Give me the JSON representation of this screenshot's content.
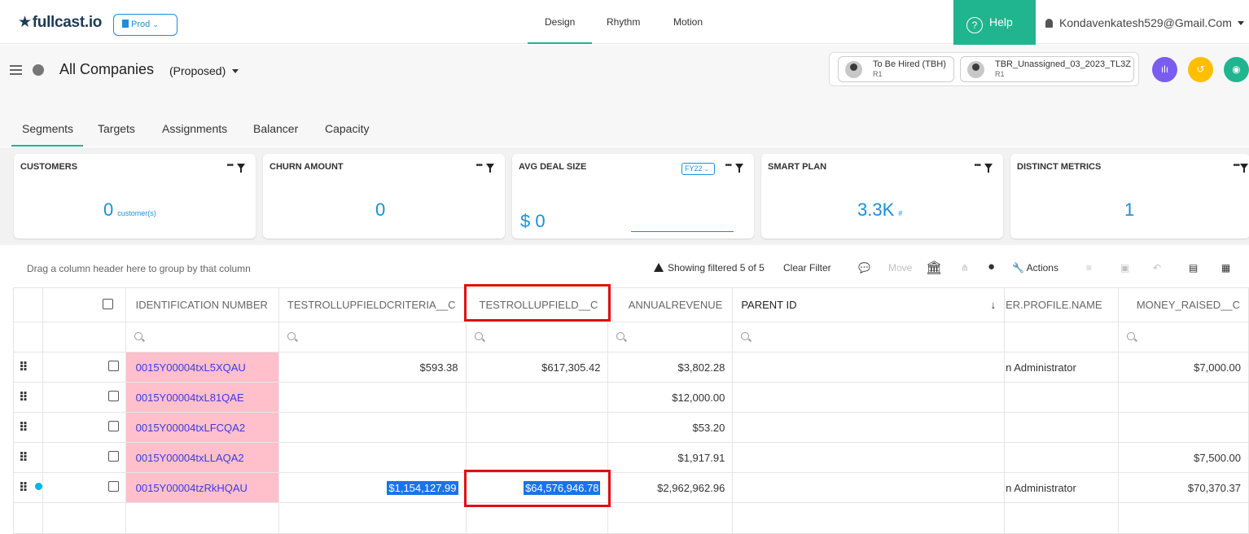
{
  "topbar": {
    "logo": "fullcast.io",
    "env_label": "Prod",
    "nav": [
      "Design",
      "Rhythm",
      "Motion"
    ],
    "help_label": "Help",
    "user_email": "Kondavenkatesh529@Gmail.Com"
  },
  "header": {
    "title": "All Companies",
    "view": "(Proposed)",
    "people": [
      {
        "name": "To Be Hired (TBH)",
        "role": "R1"
      },
      {
        "name": "TBR_Unassigned_03_2023_TL3Z",
        "role": "R1"
      }
    ],
    "colors": {
      "accent": "#20b58e",
      "link": "#1a8fd6",
      "purple": "#7b5cf0",
      "yellow": "#ffbf00",
      "teal": "#20b58e"
    }
  },
  "tabs": [
    "Segments",
    "Targets",
    "Assignments",
    "Balancer",
    "Capacity"
  ],
  "cards": [
    {
      "label": "CUSTOMERS",
      "value": "0",
      "unit": "customer(s)"
    },
    {
      "label": "CHURN AMOUNT",
      "value": "0",
      "unit": ""
    },
    {
      "label": "AVG DEAL SIZE",
      "value": "$ 0",
      "unit": "",
      "period": "FY22"
    },
    {
      "label": "SMART PLAN",
      "value": "3.3K",
      "unit": "#"
    },
    {
      "label": "DISTINCT METRICS",
      "value": "1",
      "unit": ""
    }
  ],
  "grid_toolbar": {
    "drag_hint": "Drag a column header here to group by that column",
    "filter_status": "Showing filtered 5 of 5",
    "clear_filter": "Clear Filter",
    "move": "Move",
    "actions": "Actions"
  },
  "table": {
    "columns": [
      "IDENTIFICATION NUMBER",
      "TESTROLLUPFIELDCRITERIA__C",
      "TESTROLLUPFIELD__C",
      "ANNUALREVENUE",
      "PARENT ID",
      "ER.PROFILE.NAME",
      "MONEY_RAISED__C"
    ],
    "rows": [
      {
        "id": "0015Y00004txL5XQAU",
        "criteria": "$593.38",
        "rollup": "$617,305.42",
        "revenue": "$3,802.28",
        "parent": "",
        "profile": "n Administrator",
        "money": "$7,000.00"
      },
      {
        "id": "0015Y00004txL81QAE",
        "criteria": "",
        "rollup": "",
        "revenue": "$12,000.00",
        "parent": "",
        "profile": "",
        "money": ""
      },
      {
        "id": "0015Y00004txLFCQA2",
        "criteria": "",
        "rollup": "",
        "revenue": "$53.20",
        "parent": "",
        "profile": "",
        "money": ""
      },
      {
        "id": "0015Y00004txLLAQA2",
        "criteria": "",
        "rollup": "",
        "revenue": "$1,917.91",
        "parent": "",
        "profile": "",
        "money": "$7,500.00"
      },
      {
        "id": "0015Y00004tzRkHQAU",
        "criteria": "$1,154,127.99",
        "rollup": "$64,576,946.78",
        "revenue": "$2,962,962.96",
        "parent": "",
        "profile": "n Administrator",
        "money": "$70,370.37"
      }
    ]
  }
}
